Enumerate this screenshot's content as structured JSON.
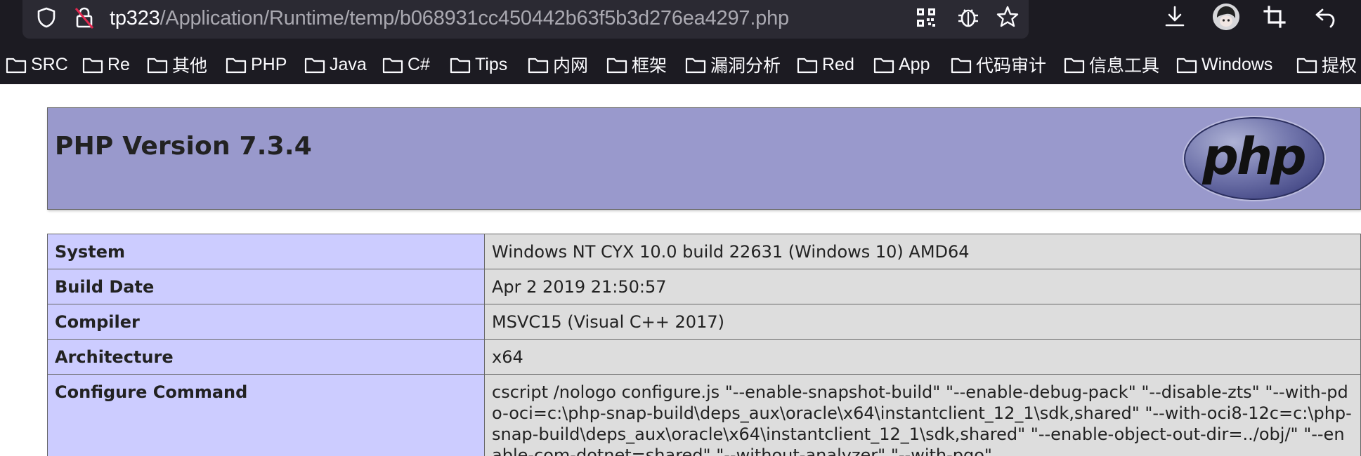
{
  "browser": {
    "url_host": "tp323",
    "url_path": "/Application/Runtime/temp/b068931cc450442b63f5b3d276ea4297.php",
    "icons": [
      "shield-icon",
      "lock-crossed-icon",
      "qr-code-icon",
      "bug-icon",
      "star-icon",
      "download-icon",
      "avatar",
      "crop-icon",
      "back-icon"
    ],
    "bookmarks": [
      "SRC",
      "Re",
      "其他",
      "PHP",
      "Java",
      "C#",
      "Tips",
      "内网",
      "框架",
      "漏洞分析",
      "Red",
      "App",
      "代码审计",
      "信息工具",
      "Windows",
      "提权"
    ]
  },
  "phpinfo": {
    "title": "PHP Version 7.3.4",
    "logo_text": "php",
    "rows": [
      {
        "key": "System",
        "value": "Windows NT CYX 10.0 build 22631 (Windows 10) AMD64"
      },
      {
        "key": "Build Date",
        "value": "Apr 2 2019 21:50:57"
      },
      {
        "key": "Compiler",
        "value": "MSVC15 (Visual C++ 2017)"
      },
      {
        "key": "Architecture",
        "value": "x64"
      },
      {
        "key": "Configure Command",
        "value": "cscript /nologo configure.js \"--enable-snapshot-build\" \"--enable-debug-pack\" \"--disable-zts\" \"--with-pdo-oci=c:\\php-snap-build\\deps_aux\\oracle\\x64\\instantclient_12_1\\sdk,shared\" \"--with-oci8-12c=c:\\php-snap-build\\deps_aux\\oracle\\x64\\instantclient_12_1\\sdk,shared\" \"--enable-object-out-dir=../obj/\" \"--enable-com-dotnet=shared\" \"--without-analyzer\" \"--with-pgo\""
      }
    ]
  },
  "colors": {
    "chrome_bg": "#1c1b22",
    "urlbar_bg": "#2b2a33",
    "header_bg": "#9999cc",
    "key_cell_bg": "#ccccff",
    "value_cell_bg": "#dddddd"
  }
}
